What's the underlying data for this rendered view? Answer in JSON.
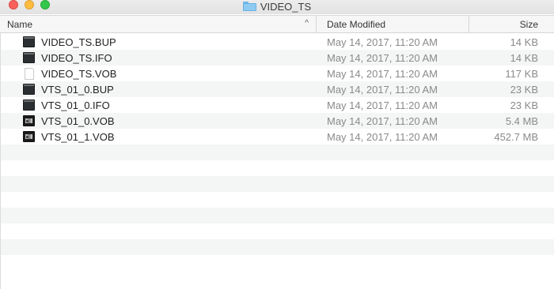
{
  "window": {
    "title": "VIDEO_TS"
  },
  "columns": {
    "name": "Name",
    "date": "Date Modified",
    "size": "Size",
    "sort_indicator": "^"
  },
  "files": [
    {
      "name": "VIDEO_TS.BUP",
      "date": "May 14, 2017, 11:20 AM",
      "size": "14 KB",
      "icon": "executable-file-icon"
    },
    {
      "name": "VIDEO_TS.IFO",
      "date": "May 14, 2017, 11:20 AM",
      "size": "14 KB",
      "icon": "executable-file-icon"
    },
    {
      "name": "VIDEO_TS.VOB",
      "date": "May 14, 2017, 11:20 AM",
      "size": "117 KB",
      "icon": "blank-document-icon"
    },
    {
      "name": "VTS_01_0.BUP",
      "date": "May 14, 2017, 11:20 AM",
      "size": "23 KB",
      "icon": "executable-file-icon"
    },
    {
      "name": "VTS_01_0.IFO",
      "date": "May 14, 2017, 11:20 AM",
      "size": "23 KB",
      "icon": "executable-file-icon"
    },
    {
      "name": "VTS_01_0.VOB",
      "date": "May 14, 2017, 11:20 AM",
      "size": "5.4 MB",
      "icon": "video-file-icon"
    },
    {
      "name": "VTS_01_1.VOB",
      "date": "May 14, 2017, 11:20 AM",
      "size": "452.7 MB",
      "icon": "video-file-icon"
    }
  ],
  "empty_row_count": 8,
  "colors": {
    "close": "#fc605c",
    "minimize": "#fdbc40",
    "zoom": "#34c84a",
    "folder": "#8fcaf2",
    "alt_row": "#f4f5f5",
    "secondary_text": "#8a8a8a"
  }
}
